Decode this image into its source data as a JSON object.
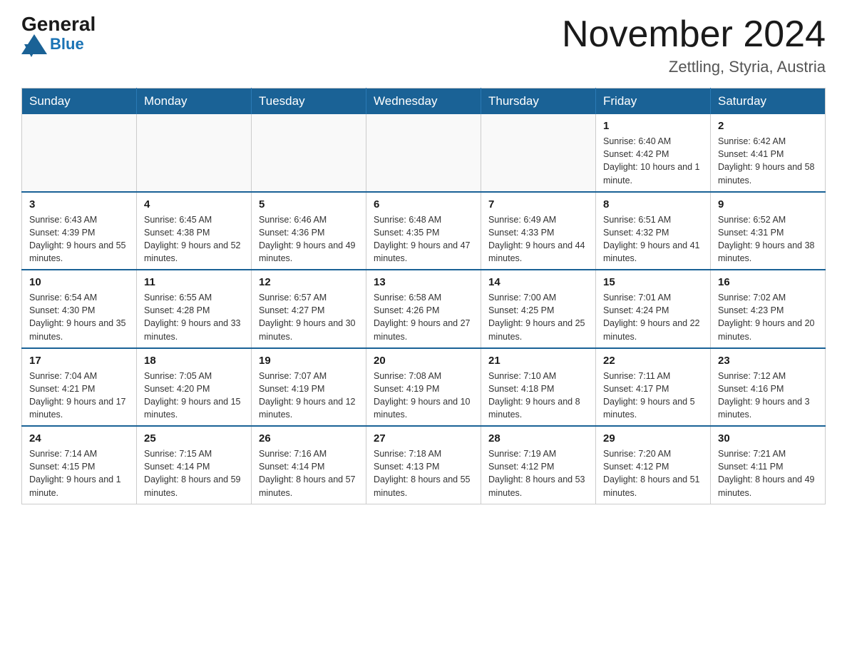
{
  "header": {
    "logo_general": "General",
    "logo_blue": "Blue",
    "month_title": "November 2024",
    "location": "Zettling, Styria, Austria"
  },
  "days_of_week": [
    "Sunday",
    "Monday",
    "Tuesday",
    "Wednesday",
    "Thursday",
    "Friday",
    "Saturday"
  ],
  "weeks": [
    [
      {
        "day": "",
        "info": ""
      },
      {
        "day": "",
        "info": ""
      },
      {
        "day": "",
        "info": ""
      },
      {
        "day": "",
        "info": ""
      },
      {
        "day": "",
        "info": ""
      },
      {
        "day": "1",
        "info": "Sunrise: 6:40 AM\nSunset: 4:42 PM\nDaylight: 10 hours and 1 minute."
      },
      {
        "day": "2",
        "info": "Sunrise: 6:42 AM\nSunset: 4:41 PM\nDaylight: 9 hours and 58 minutes."
      }
    ],
    [
      {
        "day": "3",
        "info": "Sunrise: 6:43 AM\nSunset: 4:39 PM\nDaylight: 9 hours and 55 minutes."
      },
      {
        "day": "4",
        "info": "Sunrise: 6:45 AM\nSunset: 4:38 PM\nDaylight: 9 hours and 52 minutes."
      },
      {
        "day": "5",
        "info": "Sunrise: 6:46 AM\nSunset: 4:36 PM\nDaylight: 9 hours and 49 minutes."
      },
      {
        "day": "6",
        "info": "Sunrise: 6:48 AM\nSunset: 4:35 PM\nDaylight: 9 hours and 47 minutes."
      },
      {
        "day": "7",
        "info": "Sunrise: 6:49 AM\nSunset: 4:33 PM\nDaylight: 9 hours and 44 minutes."
      },
      {
        "day": "8",
        "info": "Sunrise: 6:51 AM\nSunset: 4:32 PM\nDaylight: 9 hours and 41 minutes."
      },
      {
        "day": "9",
        "info": "Sunrise: 6:52 AM\nSunset: 4:31 PM\nDaylight: 9 hours and 38 minutes."
      }
    ],
    [
      {
        "day": "10",
        "info": "Sunrise: 6:54 AM\nSunset: 4:30 PM\nDaylight: 9 hours and 35 minutes."
      },
      {
        "day": "11",
        "info": "Sunrise: 6:55 AM\nSunset: 4:28 PM\nDaylight: 9 hours and 33 minutes."
      },
      {
        "day": "12",
        "info": "Sunrise: 6:57 AM\nSunset: 4:27 PM\nDaylight: 9 hours and 30 minutes."
      },
      {
        "day": "13",
        "info": "Sunrise: 6:58 AM\nSunset: 4:26 PM\nDaylight: 9 hours and 27 minutes."
      },
      {
        "day": "14",
        "info": "Sunrise: 7:00 AM\nSunset: 4:25 PM\nDaylight: 9 hours and 25 minutes."
      },
      {
        "day": "15",
        "info": "Sunrise: 7:01 AM\nSunset: 4:24 PM\nDaylight: 9 hours and 22 minutes."
      },
      {
        "day": "16",
        "info": "Sunrise: 7:02 AM\nSunset: 4:23 PM\nDaylight: 9 hours and 20 minutes."
      }
    ],
    [
      {
        "day": "17",
        "info": "Sunrise: 7:04 AM\nSunset: 4:21 PM\nDaylight: 9 hours and 17 minutes."
      },
      {
        "day": "18",
        "info": "Sunrise: 7:05 AM\nSunset: 4:20 PM\nDaylight: 9 hours and 15 minutes."
      },
      {
        "day": "19",
        "info": "Sunrise: 7:07 AM\nSunset: 4:19 PM\nDaylight: 9 hours and 12 minutes."
      },
      {
        "day": "20",
        "info": "Sunrise: 7:08 AM\nSunset: 4:19 PM\nDaylight: 9 hours and 10 minutes."
      },
      {
        "day": "21",
        "info": "Sunrise: 7:10 AM\nSunset: 4:18 PM\nDaylight: 9 hours and 8 minutes."
      },
      {
        "day": "22",
        "info": "Sunrise: 7:11 AM\nSunset: 4:17 PM\nDaylight: 9 hours and 5 minutes."
      },
      {
        "day": "23",
        "info": "Sunrise: 7:12 AM\nSunset: 4:16 PM\nDaylight: 9 hours and 3 minutes."
      }
    ],
    [
      {
        "day": "24",
        "info": "Sunrise: 7:14 AM\nSunset: 4:15 PM\nDaylight: 9 hours and 1 minute."
      },
      {
        "day": "25",
        "info": "Sunrise: 7:15 AM\nSunset: 4:14 PM\nDaylight: 8 hours and 59 minutes."
      },
      {
        "day": "26",
        "info": "Sunrise: 7:16 AM\nSunset: 4:14 PM\nDaylight: 8 hours and 57 minutes."
      },
      {
        "day": "27",
        "info": "Sunrise: 7:18 AM\nSunset: 4:13 PM\nDaylight: 8 hours and 55 minutes."
      },
      {
        "day": "28",
        "info": "Sunrise: 7:19 AM\nSunset: 4:12 PM\nDaylight: 8 hours and 53 minutes."
      },
      {
        "day": "29",
        "info": "Sunrise: 7:20 AM\nSunset: 4:12 PM\nDaylight: 8 hours and 51 minutes."
      },
      {
        "day": "30",
        "info": "Sunrise: 7:21 AM\nSunset: 4:11 PM\nDaylight: 8 hours and 49 minutes."
      }
    ]
  ]
}
